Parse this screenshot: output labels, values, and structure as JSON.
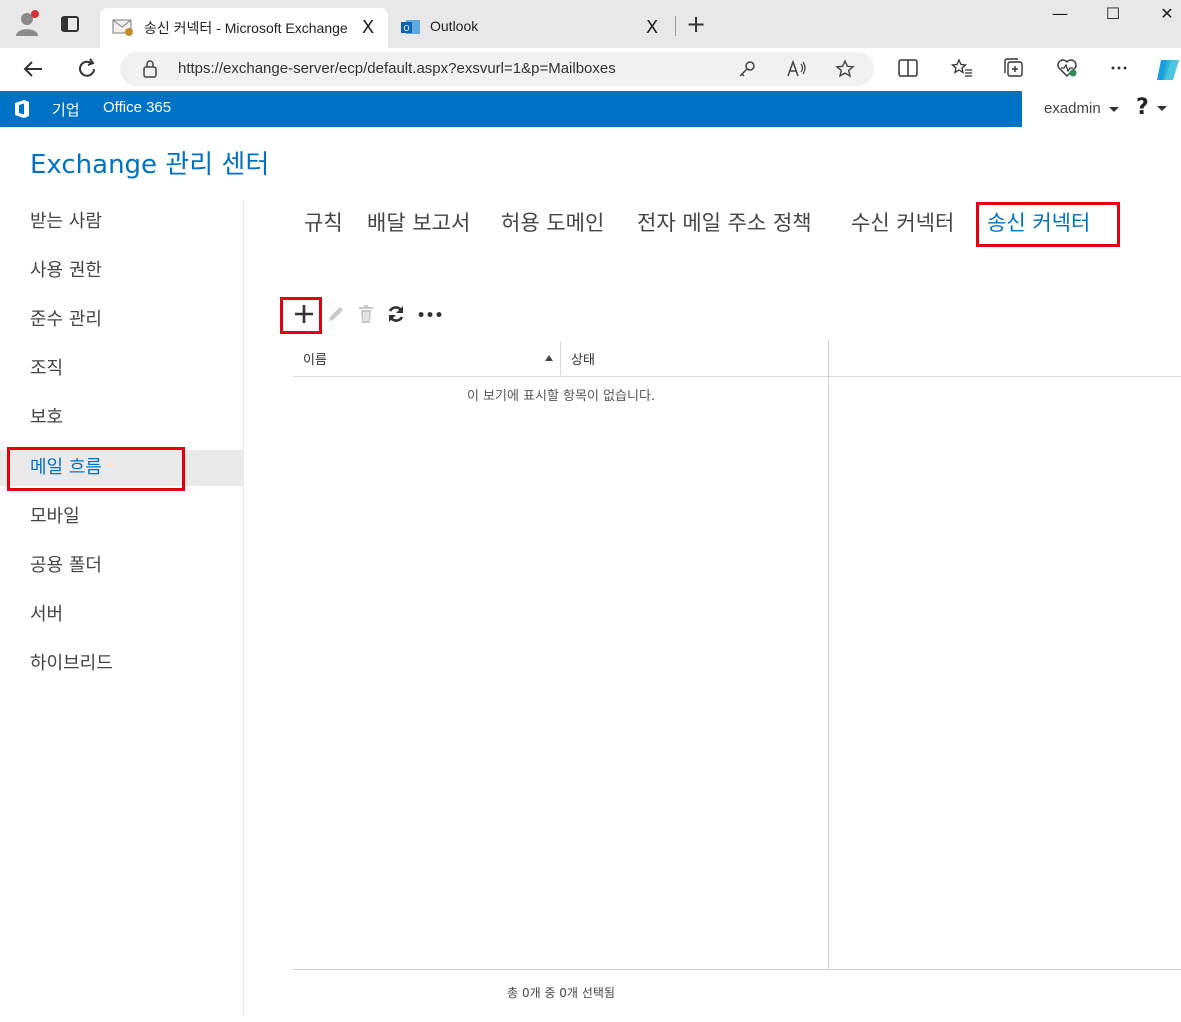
{
  "browser": {
    "tabs": [
      {
        "title": "송신 커넥터 - Microsoft Exchange",
        "active": true
      },
      {
        "title": "Outlook",
        "active": false
      }
    ],
    "url": "https://exchange-server/ecp/default.aspx?exsvurl=1&p=Mailboxes",
    "new_tab_label": "+",
    "close_label": "X",
    "window_controls": {
      "minimize": "—",
      "maximize": "☐",
      "close": "✕"
    }
  },
  "o365_bar": {
    "enterprise_label": "기업",
    "office365_label": "Office 365",
    "user": "exadmin",
    "help_label": "?"
  },
  "app": {
    "title": "Exchange 관리 센터"
  },
  "left_nav": {
    "items": [
      {
        "label": "받는 사람",
        "selected": false
      },
      {
        "label": "사용 권한",
        "selected": false
      },
      {
        "label": "준수 관리",
        "selected": false
      },
      {
        "label": "조직",
        "selected": false
      },
      {
        "label": "보호",
        "selected": false
      },
      {
        "label": "메일 흐름",
        "selected": true
      },
      {
        "label": "모바일",
        "selected": false
      },
      {
        "label": "공용 폴더",
        "selected": false
      },
      {
        "label": "서버",
        "selected": false
      },
      {
        "label": "하이브리드",
        "selected": false
      }
    ]
  },
  "tabs": [
    {
      "label": "규칙",
      "active": false
    },
    {
      "label": "배달 보고서",
      "active": false
    },
    {
      "label": "허용 도메인",
      "active": false
    },
    {
      "label": "전자 메일 주소 정책",
      "active": false
    },
    {
      "label": "수신 커넥터",
      "active": false
    },
    {
      "label": "송신 커넥터",
      "active": true
    }
  ],
  "toolbar": {
    "icons": [
      "add-icon",
      "edit-icon",
      "delete-icon",
      "refresh-icon",
      "more-icon"
    ],
    "more_label": "•••"
  },
  "grid": {
    "columns": [
      "이름",
      "상태"
    ],
    "sorted_column": "이름",
    "empty_message": "이 보기에 표시할 항목이 없습니다.",
    "status": "총 0개 중 0개 선택됨"
  },
  "colors": {
    "accent": "#0072c6",
    "highlight": "#e3000f"
  }
}
